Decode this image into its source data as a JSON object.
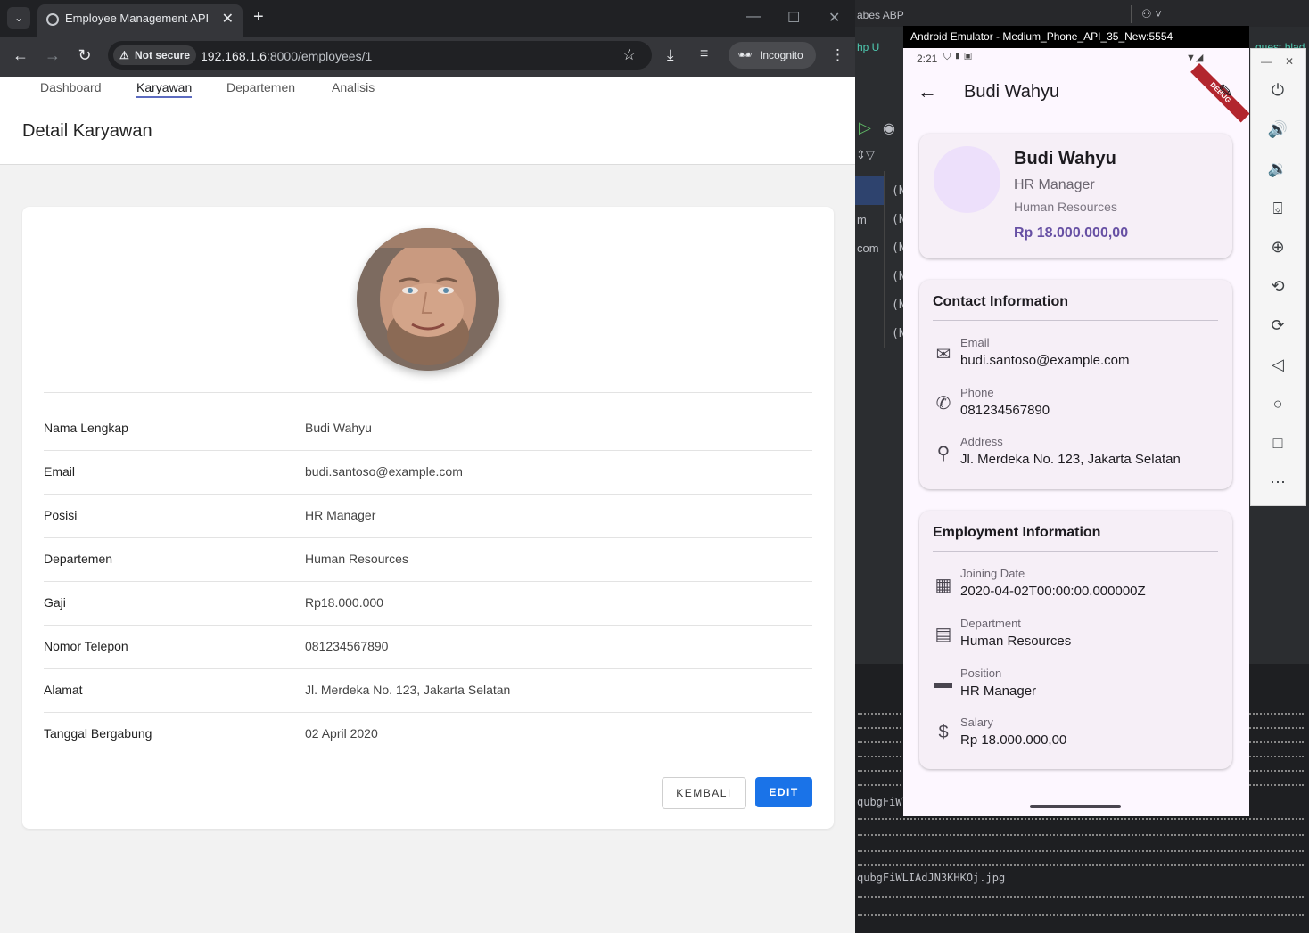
{
  "browser": {
    "tab_title": "Employee Management API",
    "security_label": "Not secure",
    "url_host": "192.168.1.6",
    "url_path": ":8000/employees/1",
    "incognito_label": "Incognito"
  },
  "nav": {
    "items": [
      "Dashboard",
      "Karyawan",
      "Departemen",
      "Analisis"
    ],
    "active": "Karyawan"
  },
  "page": {
    "title": "Detail Karyawan"
  },
  "details": [
    {
      "label": "Nama Lengkap",
      "value": "Budi Wahyu"
    },
    {
      "label": "Email",
      "value": "budi.santoso@example.com"
    },
    {
      "label": "Posisi",
      "value": "HR Manager"
    },
    {
      "label": "Departemen",
      "value": "Human Resources"
    },
    {
      "label": "Gaji",
      "value": "Rp18.000.000"
    },
    {
      "label": "Nomor Telepon",
      "value": "081234567890"
    },
    {
      "label": "Alamat",
      "value": "Jl. Merdeka No. 123, Jakarta Selatan"
    },
    {
      "label": "Tanggal Bergabung",
      "value": "02 April 2020"
    }
  ],
  "actions": {
    "back_label": "KEMBALI",
    "edit_label": "EDIT"
  },
  "ide": {
    "tab_fragment": "abes ABP",
    "php_fragment": "hp U",
    "guest_fragment": "guest blad",
    "list_fragments": [
      "m",
      "com"
    ],
    "null_fragment": "(N",
    "file_fragment_1": "qubgFiWl",
    "file_fragment_2": "qubgFiWLIAdJN3KHKOj.jpg"
  },
  "emulator": {
    "window_title": "Android Emulator - Medium_Phone_API_35_New:5554",
    "status_time": "2:21",
    "debug_banner": "DEBUG",
    "appbar_title": "Budi Wahyu",
    "profile": {
      "name": "Budi Wahyu",
      "position": "HR Manager",
      "department": "Human Resources",
      "salary": "Rp 18.000.000,00"
    },
    "contact": {
      "heading": "Contact Information",
      "items": [
        {
          "label": "Email",
          "value": "budi.santoso@example.com",
          "icon": "mail-icon"
        },
        {
          "label": "Phone",
          "value": "081234567890",
          "icon": "phone-icon"
        },
        {
          "label": "Address",
          "value": "Jl. Merdeka No. 123, Jakarta Selatan",
          "icon": "location-icon"
        }
      ]
    },
    "employment": {
      "heading": "Employment Information",
      "items": [
        {
          "label": "Joining Date",
          "value": "2020-04-02T00:00:00.000000Z",
          "icon": "calendar-icon"
        },
        {
          "label": "Department",
          "value": "Human Resources",
          "icon": "building-icon"
        },
        {
          "label": "Position",
          "value": "HR Manager",
          "icon": "briefcase-icon"
        },
        {
          "label": "Salary",
          "value": "Rp 18.000.000,00",
          "icon": "dollar-icon"
        }
      ]
    }
  },
  "colors": {
    "accent_blue": "#1a73e8",
    "salary_purple": "#6750a4",
    "avatar_lilac": "#ede0fb"
  }
}
